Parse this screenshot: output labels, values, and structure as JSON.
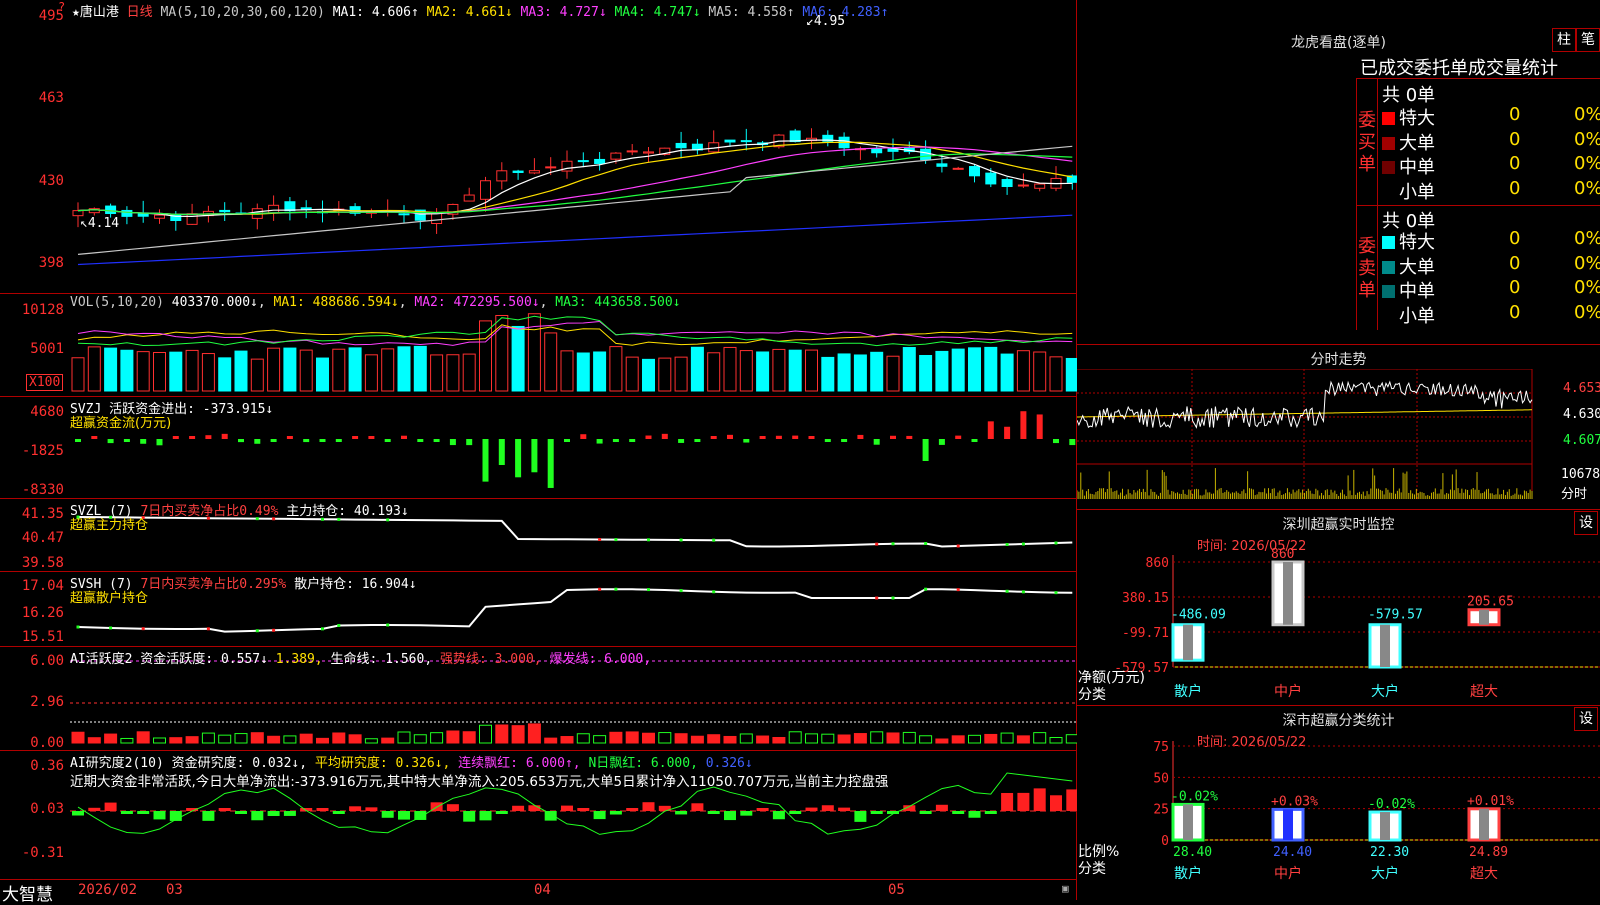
{
  "header": {
    "title": "★唐山港",
    "period": "日线",
    "ma_label": "MA(5,10,20,30,60,120)",
    "ma1": "MA1: 4.606↑",
    "ma2": "MA2: 4.661↓",
    "ma3": "MA3: 4.727↓",
    "ma4": "MA4: 4.747↓",
    "ma5": "MA5: 4.558↑",
    "ma6": "MA6: 4.283↑",
    "high_mark": "4.95",
    "low_mark": "4.14",
    "question": "?"
  },
  "price_axis": [
    "495",
    "463",
    "430",
    "398"
  ],
  "vol": {
    "legend": "VOL(5,10,20)",
    "value": "403370.000↓",
    "ma1": "MA1: 488686.594↓",
    "ma2": "MA2: 472295.500↓",
    "ma3": "MA3: 443658.500↓",
    "axis": [
      "10128",
      "5001"
    ],
    "unit_button": "X100"
  },
  "svzj": {
    "legend": "SVZJ  活跃资金进出: -373.915↓",
    "sub": "超赢资金流(万元)",
    "axis": [
      "4680",
      "-1825",
      "-8330"
    ]
  },
  "svzl": {
    "legend_a": "SVZL (7)",
    "legend_b": "7日内买卖净占比0.49%",
    "legend_c": "主力持仓: 40.193↓",
    "sub": "超赢主力持仓",
    "axis": [
      "41.35",
      "40.47",
      "39.58"
    ]
  },
  "svsh": {
    "legend_a": "SVSH (7)",
    "legend_b": "7日内买卖净占比0.295%",
    "legend_c": "散户持仓: 16.904↓",
    "sub": "超赢散户持仓",
    "axis": [
      "17.04",
      "16.26",
      "15.51"
    ]
  },
  "ai1": {
    "legend_a": "AI活跃度2 资金活跃度: 0.557↓",
    "legend_b": "1.389,",
    "legend_c": "生命线: 1.560,",
    "legend_d": "强势线: 3.000,",
    "legend_e": "爆发线: 6.000,",
    "axis": [
      "6.00",
      "2.96",
      "0.00"
    ]
  },
  "ai2": {
    "legend_a": "AI研究度2(10) 资金研究度: 0.032↓,",
    "legend_b": "平均研究度: 0.326↓,",
    "legend_c": "连续飘红: 6.000↑,",
    "legend_d": "N日飘红: 6.000,",
    "legend_e": "0.326↓",
    "note": "近期大资金非常活跃,今日大单净流出:-373.916万元,其中特大单净流入:205.653万元,大单5日累计净入11050.707万元,当前主力控盘强",
    "axis": [
      "0.36",
      "0.03",
      "-0.31"
    ]
  },
  "bottom": {
    "brand": "大智慧",
    "dates": [
      "2026/02",
      "03",
      "04",
      "05"
    ]
  },
  "lhkp": {
    "title": "龙虎看盘(逐单)",
    "btn_zhu": "柱",
    "btn_bi": "笔",
    "tabs": "已成交委托单成交量统计",
    "buy_label": "委买单",
    "sell_label": "委卖单",
    "buy_total": "共 0单",
    "sell_total": "共 0单",
    "buy_rows": [
      {
        "name": "特大",
        "count": "0",
        "pct": "0%",
        "color": "#ff0000"
      },
      {
        "name": "大单",
        "count": "0",
        "pct": "0%",
        "color": "#a00000"
      },
      {
        "name": "中单",
        "count": "0",
        "pct": "0%",
        "color": "#700000"
      },
      {
        "name": "小单",
        "count": "0",
        "pct": "0%",
        "color": "#000000"
      }
    ],
    "sell_rows": [
      {
        "name": "特大",
        "count": "0",
        "pct": "0%",
        "color": "#00ffff"
      },
      {
        "name": "大单",
        "count": "0",
        "pct": "0%",
        "color": "#008b8b"
      },
      {
        "name": "中单",
        "count": "0",
        "pct": "0%",
        "color": "#007070"
      },
      {
        "name": "小单",
        "count": "0",
        "pct": "0%",
        "color": "#000000"
      }
    ]
  },
  "intraday": {
    "title": "分时走势",
    "prices": [
      "4.653",
      "4.630",
      "4.607"
    ],
    "vol_label": "10678",
    "vol_unit": "分时"
  },
  "sz_monitor": {
    "title": "深圳超赢实时监控",
    "btn": "设",
    "time": "时间: 2026/05/22",
    "axis": [
      "860",
      "380.15",
      "-99.71",
      "-579.57"
    ],
    "ylabel": "净额(万元)",
    "xlabel": "分类",
    "categories": [
      "散户",
      "中户",
      "大户",
      "超大"
    ],
    "values": [
      -486.09,
      860,
      -579.57,
      205.65
    ],
    "value_labels": [
      "-486.09",
      "860",
      "-579.57",
      "205.65"
    ]
  },
  "sz_class": {
    "title": "深市超赢分类统计",
    "btn": "设",
    "time": "时间: 2026/05/22",
    "axis": [
      "75",
      "50",
      "25",
      "0"
    ],
    "ylabel": "比例%",
    "xlabel": "分类",
    "categories": [
      "散户",
      "中户",
      "大户",
      "超大"
    ],
    "values": [
      28.4,
      24.4,
      22.3,
      24.89
    ],
    "value_labels": [
      "28.40",
      "24.40",
      "22.30",
      "24.89"
    ],
    "changes": [
      "-0.02%",
      "+0.03%",
      "-0.02%",
      "+0.01%"
    ]
  }
}
